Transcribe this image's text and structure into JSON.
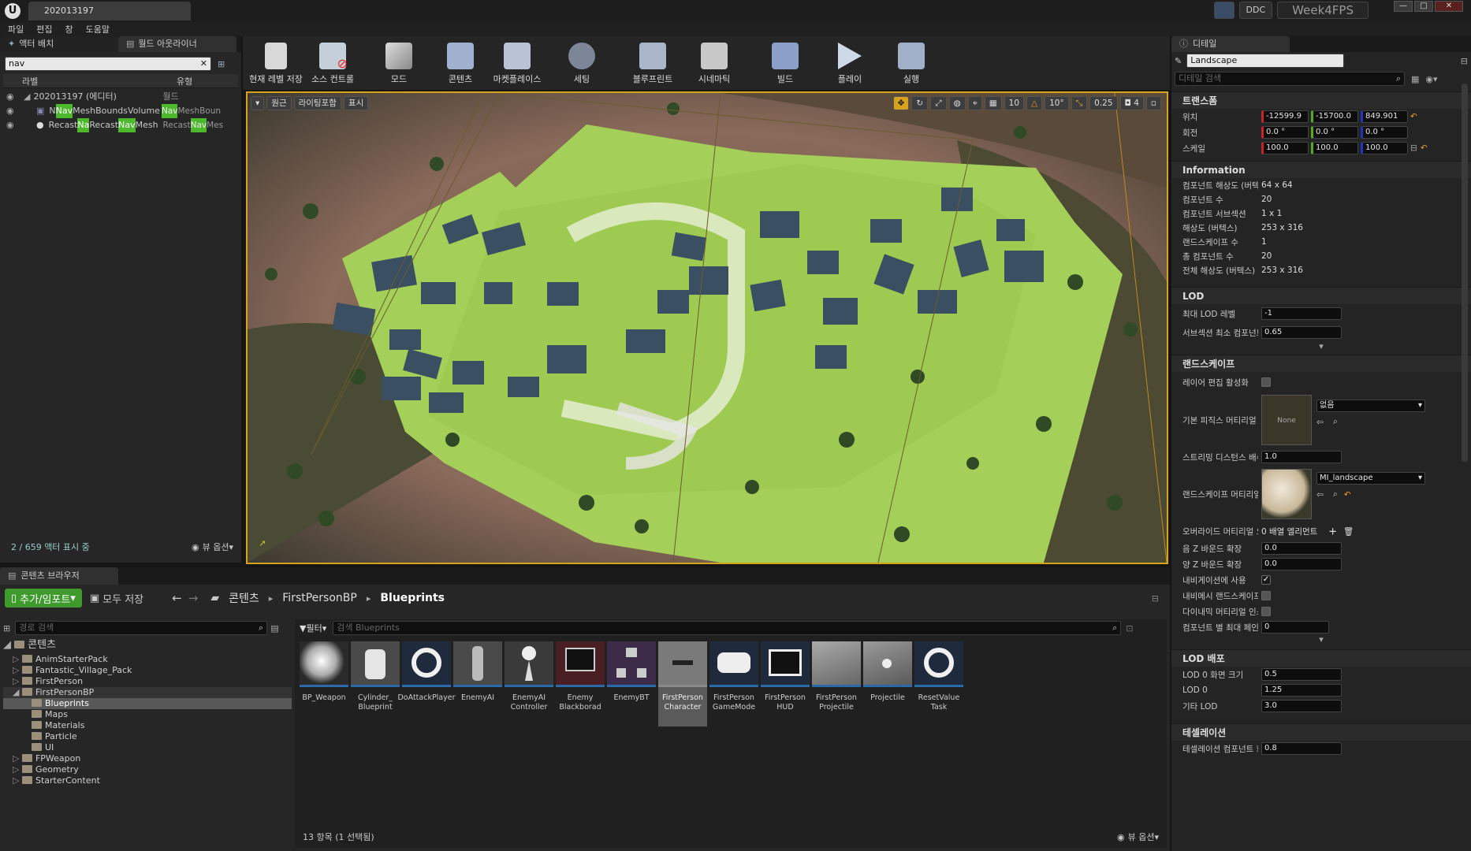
{
  "titlebar": {
    "level_tab": "202013197",
    "ddc": "DDC",
    "project": "Week4FPS"
  },
  "menu": [
    "파일",
    "편집",
    "창",
    "도움말"
  ],
  "outliner": {
    "tab_actor": "액터 배치",
    "tab_world": "월드 아웃라이너",
    "search_value": "nav",
    "col_label": "라벨",
    "col_type": "유형",
    "root": "202013197 (에디터)",
    "root_type": "월드",
    "row1_pre": "N",
    "row1_hl": "Nav",
    "row1_post": "MeshBoundsVolume",
    "row1_t_hl": "Nav",
    "row1_t_post": "MeshBoun",
    "row2_pre": "Recast",
    "row2_a": "Na",
    "row2_mid": "Recast",
    "row2_b": "Nav",
    "row2_post": "Mesh",
    "row2_t_pre": "Recast",
    "row2_t_hl": "Nav",
    "row2_t_post": "Mes",
    "status": "2 / 659 액터 표시 중",
    "view_options": "뷰 옵션"
  },
  "toolbar": [
    {
      "label": "현재 레벨 저장",
      "icon": "save-icon"
    },
    {
      "label": "소스 컨트롤",
      "icon": "source-control-icon"
    },
    {
      "label": "모드",
      "icon": "modes-icon"
    },
    {
      "label": "콘텐츠",
      "icon": "content-icon"
    },
    {
      "label": "마켓플레이스",
      "icon": "marketplace-icon"
    },
    {
      "label": "세팅",
      "icon": "settings-icon"
    },
    {
      "label": "블루프린트",
      "icon": "blueprint-icon"
    },
    {
      "label": "시네마틱",
      "icon": "cinematic-icon"
    },
    {
      "label": "빌드",
      "icon": "build-icon"
    },
    {
      "label": "플레이",
      "icon": "play-icon"
    },
    {
      "label": "실행",
      "icon": "launch-icon"
    }
  ],
  "viewport": {
    "perspective": "원근",
    "lighting": "라이팅포함",
    "show": "표시",
    "grid": "10",
    "angle": "10°",
    "scale": "0.25",
    "cam": "4"
  },
  "content_browser": {
    "tab": "콘텐츠 브라우저",
    "add_import": "추가/임포트",
    "save_all": "모두 저장",
    "crumbs": [
      "콘텐츠",
      "FirstPersonBP",
      "Blueprints"
    ],
    "path_search_placeholder": "경로 검색",
    "filter": "필터",
    "asset_search_placeholder": "검색 Blueprints",
    "tree": [
      "콘텐츠",
      "AnimStarterPack",
      "Fantastic_Village_Pack",
      "FirstPerson",
      "FirstPersonBP",
      "Blueprints",
      "Maps",
      "Materials",
      "Particle",
      "UI",
      "FPWeapon",
      "Geometry",
      "StarterContent"
    ],
    "assets": [
      {
        "name": "BP_Weapon"
      },
      {
        "name": "Cylinder_ Blueprint"
      },
      {
        "name": "DoAttackPlayer"
      },
      {
        "name": "EnemyAI"
      },
      {
        "name": "EnemyAI Controller"
      },
      {
        "name": "Enemy Blackborad"
      },
      {
        "name": "EnemyBT"
      },
      {
        "name": "FirstPerson Character"
      },
      {
        "name": "FirstPerson GameMode"
      },
      {
        "name": "FirstPerson HUD"
      },
      {
        "name": "FirstPerson Projectile"
      },
      {
        "name": "Projectile"
      },
      {
        "name": "ResetValue Task"
      }
    ],
    "count": "13 항목 (1 선택됨)",
    "view_options": "뷰 옵션"
  },
  "details": {
    "tab": "디테일",
    "object_name": "Landscape",
    "search_placeholder": "디테일 검색",
    "transform": {
      "header": "트랜스폼",
      "loc_label": "위치",
      "loc": [
        "-12599.9",
        "-15700.0",
        "849.901"
      ],
      "rot_label": "회전",
      "rot": [
        "0.0 °",
        "0.0 °",
        "0.0 °"
      ],
      "scale_label": "스케일",
      "scale": [
        "100.0",
        "100.0",
        "100.0"
      ]
    },
    "info": {
      "header": "Information",
      "rows": [
        [
          "컴포넌트 해상도 (버텍스",
          "64 x 64"
        ],
        [
          "컴포넌트 수",
          "20"
        ],
        [
          "컴포넌트 서브섹션",
          "1 x 1"
        ],
        [
          "해상도 (버텍스)",
          "253 x 316"
        ],
        [
          "랜드스케이프 수",
          "1"
        ],
        [
          "총 컴포넌트 수",
          "20"
        ],
        [
          "전체 해상도 (버텍스)",
          "253 x 316"
        ]
      ]
    },
    "lod": {
      "header": "LOD",
      "max_lod_label": "최대 LOD 레벨",
      "max_lod": "-1",
      "subsection_label": "서브섹션 최소 컴포넌트",
      "subsection": "0.65"
    },
    "landscape": {
      "header": "랜드스케이프",
      "layer_edit": "레이어 편집 활성화",
      "default_phys": "기본 피직스 머티리얼",
      "none_thumb": "None",
      "phys_value": "없음",
      "stream_label": "스트리밍 디스턴스 배수",
      "stream": "1.0",
      "mat_label": "랜드스케이프 머티리얼",
      "mat_value": "MI_landscape",
      "override_label": "오버라이드 머티리얼 오",
      "override_value": "0 배열 엘리먼트",
      "negz_label": "음 Z 바운드 확장",
      "negz": "0.0",
      "posz_label": "양 Z 바운드 확장",
      "posz": "0.0",
      "nav_label": "내비게이션에 사용",
      "navmesh_label": "내비메시 랜드스케이프",
      "dyn_label": "다이내믹 머티리얼 인스",
      "maxpaint_label": "컴포넌트 별 최대 페인트",
      "maxpaint": "0"
    },
    "lod_dist": {
      "header": "LOD 배포",
      "lod0ss_label": "LOD 0 화면 크기",
      "lod0ss": "0.5",
      "lod0_label": "LOD 0",
      "lod0": "1.25",
      "other_label": "기타 LOD",
      "other": "3.0"
    },
    "tess": {
      "header": "테셀레이션",
      "comp_label": "테셀레이션 컴포넌트 화",
      "comp": "0.8"
    }
  }
}
